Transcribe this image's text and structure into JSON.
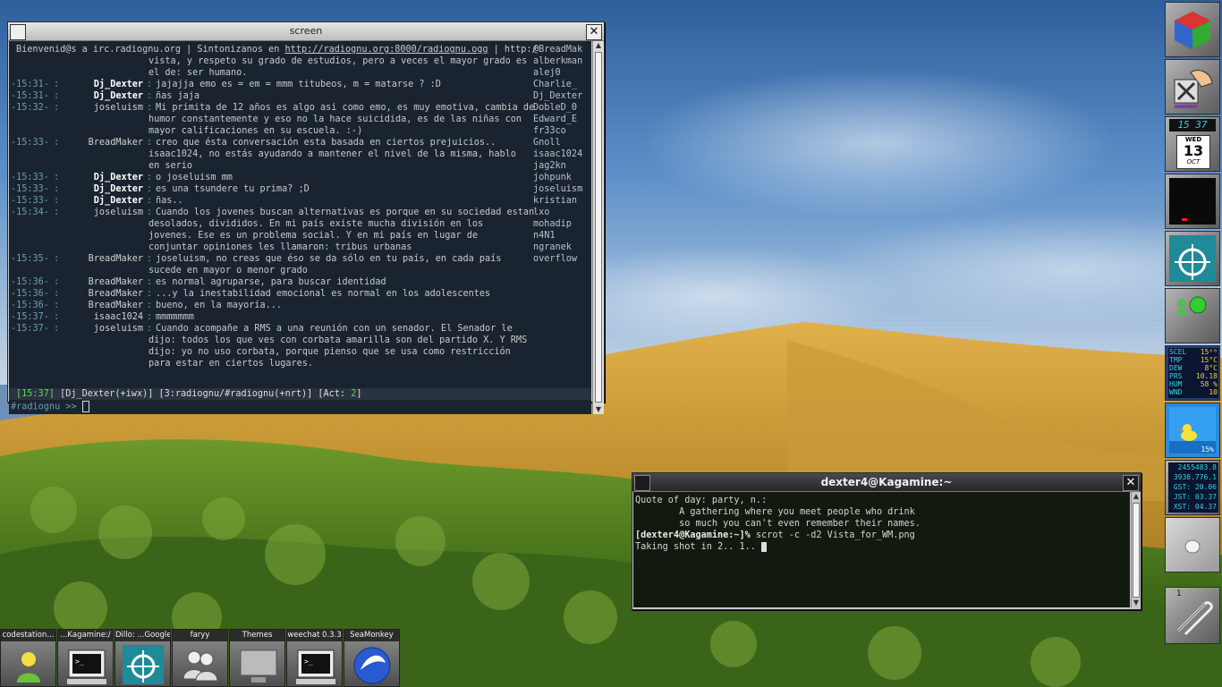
{
  "screen_window": {
    "title": "screen",
    "close_label": "✕",
    "topic": "Bienvenid@s a irc.radiognu.org | Sintonizanos en http://radiognu.org:8000/radiognu.ogg | http:/",
    "topic_prefix": "Bienvenid@s a irc.radiognu.org | Sintonizanos en ",
    "topic_url": "http://radiognu.org:8000/radiognu.ogg",
    "topic_suffix": " | http:/",
    "messages": [
      {
        "ts": "",
        "sep": "",
        "nick": "",
        "text": "vista, y respeto su grado de estudios, pero a veces el mayor grado es"
      },
      {
        "ts": "",
        "sep": "",
        "nick": "",
        "text": "el de: ser humano."
      },
      {
        "ts": "-15:31-",
        "sep": ":",
        "nick": "Dj_Dexter",
        "text": "jajajja emo es = em = mmm titubeos, m = matarse ? :D"
      },
      {
        "ts": "-15:31-",
        "sep": ":",
        "nick": "Dj_Dexter",
        "text": "ñas jaja"
      },
      {
        "ts": "-15:32-",
        "sep": ":",
        "nick": "joseluism",
        "text": "Mi primita de 12 años es algo asi como emo, es muy emotiva, cambia de"
      },
      {
        "ts": "",
        "sep": "",
        "nick": "",
        "text": "humor constantemente y eso no la hace suicidida, es de las niñas con"
      },
      {
        "ts": "",
        "sep": "",
        "nick": "",
        "text": "mayor calificaciones en su escuela. :-)"
      },
      {
        "ts": "-15:33-",
        "sep": ":",
        "nick": "BreadMaker",
        "text": "creo que ésta conversación esta basada en ciertos prejuicios.."
      },
      {
        "ts": "",
        "sep": "",
        "nick": "",
        "text": "isaac1024, no estás ayudando a mantener el nivel de la misma, hablo"
      },
      {
        "ts": "",
        "sep": "",
        "nick": "",
        "text": "en serio"
      },
      {
        "ts": "-15:33-",
        "sep": ":",
        "nick": "Dj_Dexter",
        "text": "o joseluism mm"
      },
      {
        "ts": "-15:33-",
        "sep": ":",
        "nick": "Dj_Dexter",
        "text": "es una tsundere tu prima? ;D"
      },
      {
        "ts": "-15:33-",
        "sep": ":",
        "nick": "Dj_Dexter",
        "text": "ñas.."
      },
      {
        "ts": "-15:34-",
        "sep": ":",
        "nick": "joseluism",
        "text": "Cuando los jovenes buscan alternativas es porque en su sociedad estan"
      },
      {
        "ts": "",
        "sep": "",
        "nick": "",
        "text": "desolados, divididos. En mi país existe mucha división en los"
      },
      {
        "ts": "",
        "sep": "",
        "nick": "",
        "text": "jovenes. Ese es un problema social. Y en mi país en lugar de"
      },
      {
        "ts": "",
        "sep": "",
        "nick": "",
        "text": "conjuntar opiniones les llamaron: tribus urbanas"
      },
      {
        "ts": "-15:35-",
        "sep": ":",
        "nick": "BreadMaker",
        "text": "joseluism, no creas que éso se da sólo en tu país, en cada país"
      },
      {
        "ts": "",
        "sep": "",
        "nick": "",
        "text": "sucede en mayor o menor grado"
      },
      {
        "ts": "-15:36-",
        "sep": ":",
        "nick": "BreadMaker",
        "text": "es normal agruparse, para buscar identidad"
      },
      {
        "ts": "-15:36-",
        "sep": ":",
        "nick": "BreadMaker",
        "text": "...y la inestabilidad emocional es normal en los adolescentes"
      },
      {
        "ts": "-15:36-",
        "sep": ":",
        "nick": "BreadMaker",
        "text": "bueno, en la mayoría..."
      },
      {
        "ts": "-15:37-",
        "sep": ":",
        "nick": "isaac1024",
        "text": "mmmmmmm"
      },
      {
        "ts": "-15:37-",
        "sep": ":",
        "nick": "joseluism",
        "text": "Cuando acompañe a RMS a una reunión con un senador. El Senador le"
      },
      {
        "ts": "",
        "sep": "",
        "nick": "",
        "text": "dijo: todos los que ves con corbata amarilla son del partido X. Y RMS"
      },
      {
        "ts": "",
        "sep": "",
        "nick": "",
        "text": "dijo: yo no uso corbata, porque pienso que se usa como restricción"
      },
      {
        "ts": "",
        "sep": "",
        "nick": "",
        "text": "para estar en ciertos lugares."
      }
    ],
    "nicklist": [
      "@BreadMak",
      "alberkman",
      "alej0",
      "Charlie_",
      "Dj_Dexter",
      "DobleD_0",
      "Edward_E",
      "fr33co",
      "Gnoll",
      "isaac1024",
      "jag2kn",
      "johpunk",
      "joseluism",
      "kristian",
      "lxo",
      "mohadip",
      "n4N1",
      "ngranek",
      "overflow"
    ],
    "status_bar": "[15:37] [Dj_Dexter(+iwx)] [3:radiognu/#radiognu(+nrt)] [Act: 2]",
    "status_time": "[15:37]",
    "status_nick": "[Dj_Dexter(+iwx)]",
    "status_chan": "[3:radiognu/#radiognu(+nrt)]",
    "status_act_prefix": "[Act: ",
    "status_act_num": "2",
    "status_act_suffix": "]",
    "prompt": "#radiognu >> "
  },
  "dexter_window": {
    "title": "dexter4@Kagamine:~",
    "close_label": "✕",
    "lines": [
      "Quote of day: party, n.:",
      "        A gathering where you meet people who drink",
      "        so much you can't even remember their names."
    ],
    "prompt": "[dexter4@Kagamine:~]%",
    "command": " scrot -c -d2 Vista_for_WM.png",
    "output": "Taking shot in 2.. 1.."
  },
  "dock": {
    "clock_time": "15 37",
    "clock_day": "WED",
    "clock_date": "13",
    "clock_month": "OCT",
    "weather": [
      {
        "k": "SCEL",
        "v": "15⁰⁰"
      },
      {
        "k": "TMP",
        "v": "15°C"
      },
      {
        "k": "DEW",
        "v": "8°C"
      },
      {
        "k": "PRS",
        "v": "10.18"
      },
      {
        "k": "HUM",
        "v": "58 %"
      },
      {
        "k": "WND",
        "v": "10"
      }
    ],
    "percent_label": "15%",
    "times": [
      "2455483.8",
      "3938.776.1",
      "GST: 20.06",
      "JST: 03.37",
      "XST: 04.37"
    ],
    "workspace_number": "1"
  },
  "taskbar": [
    {
      "label": "codestation...",
      "icon": "person-icon"
    },
    {
      "label": "...Kagamine:/",
      "icon": "terminal-icon"
    },
    {
      "label": "Dillo: ...Google",
      "icon": "ship-wheel-icon"
    },
    {
      "label": "faryy",
      "icon": "chat-people-icon"
    },
    {
      "label": "Themes",
      "icon": "monitor-icon"
    },
    {
      "label": "weechat 0.3.3",
      "icon": "terminal-icon"
    },
    {
      "label": "SeaMonkey",
      "icon": "seamonkey-icon"
    }
  ],
  "colors": {
    "sky": "#5c8fc8",
    "grass": "#d3a53a",
    "shrub": "#4e7a1c",
    "term_bg": "#1a2430"
  }
}
